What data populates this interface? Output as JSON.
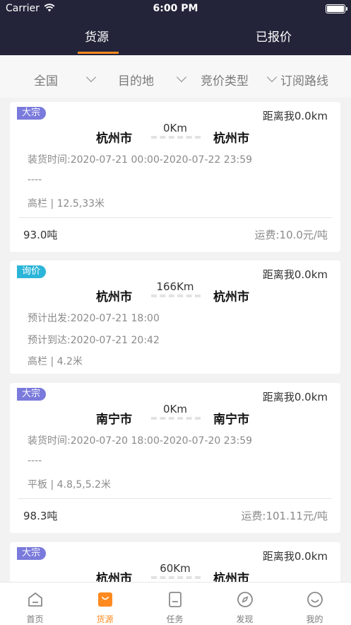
{
  "status": {
    "carrier": "Carrier",
    "time": "6:00 PM"
  },
  "tabs": [
    {
      "label": "货源"
    },
    {
      "label": "已报价"
    }
  ],
  "filters": [
    {
      "label": "全国"
    },
    {
      "label": "目的地"
    },
    {
      "label": "竞价类型"
    },
    {
      "label": "订阅路线"
    }
  ],
  "cards": [
    {
      "badge": "大宗",
      "distance": "距离我0.0km",
      "from": "杭州市",
      "to": "杭州市",
      "km": "0Km",
      "line1": "装货时间:2020-07-21 00:00-2020-07-22 23:59",
      "line2": "----",
      "spec": "高栏  |  12.5,33米",
      "weight": "93.0吨",
      "fee": "运费:10.0元/吨"
    },
    {
      "badge": "询价",
      "distance": "距离我0.0km",
      "from": "杭州市",
      "to": "杭州市",
      "km": "166Km",
      "line1": "预计出发:2020-07-21 18:00",
      "line2": "预计到达:2020-07-21 20:42",
      "spec": "高栏  |  4.2米"
    },
    {
      "badge": "大宗",
      "distance": "距离我0.0km",
      "from": "南宁市",
      "to": "南宁市",
      "km": "0Km",
      "line1": "装货时间:2020-07-20 18:00-2020-07-20 23:59",
      "line2": "----",
      "spec": "平板  |  4.8,5,5.2米",
      "weight": "98.3吨",
      "fee": "运费:101.11元/吨"
    },
    {
      "badge": "大宗",
      "distance": "距离我0.0km",
      "from": "杭州市",
      "to": "杭州市",
      "km": "60Km"
    }
  ],
  "nav": [
    {
      "label": "首页"
    },
    {
      "label": "货源"
    },
    {
      "label": "任务"
    },
    {
      "label": "发现"
    },
    {
      "label": "我的"
    }
  ],
  "colors": {
    "header": "#23243a",
    "accent": "#ff8a1f",
    "badge_bulk": "#7a7adc",
    "badge_inquiry": "#2bb5d8"
  },
  "icons": {
    "nav": [
      "home-icon",
      "cargo-bag-icon",
      "task-document-icon",
      "compass-icon",
      "smiley-icon"
    ]
  }
}
